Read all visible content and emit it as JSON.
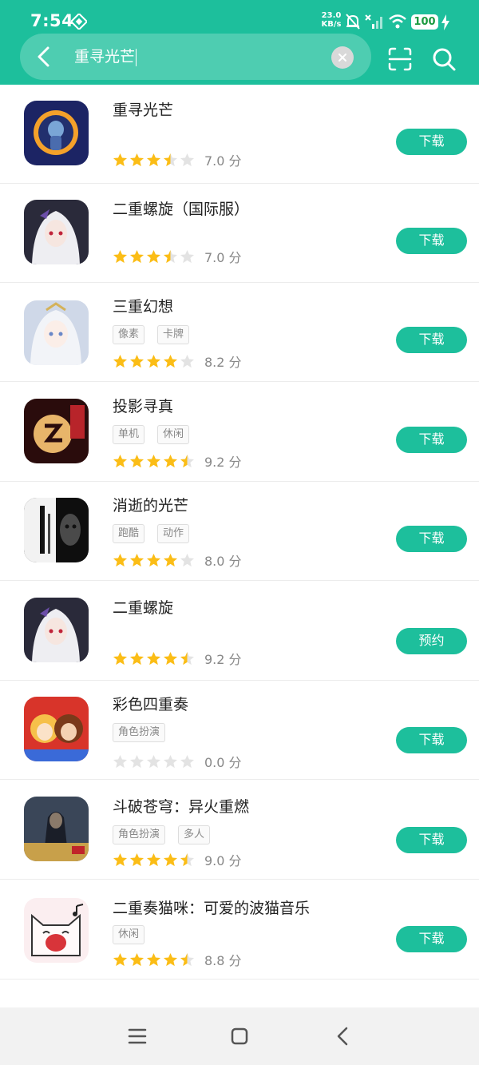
{
  "status_bar": {
    "time": "7:54",
    "net_speed_value": "23.0",
    "net_speed_unit": "KB/s",
    "battery": "100"
  },
  "search": {
    "query": "重寻光芒"
  },
  "colors": {
    "accent": "#1dbf9c",
    "star_on": "#fbbd16",
    "star_off": "#e3e3e3"
  },
  "icons": {
    "back": "chevron-left-icon",
    "clear": "close-icon",
    "scan": "scan-icon",
    "search": "search-icon",
    "nav_menu": "menu-icon",
    "nav_home": "home-square-icon",
    "nav_back": "back-triangle-icon"
  },
  "results": [
    {
      "name": "重寻光芒",
      "tags": [],
      "stars": 3.5,
      "score": "7.0 分",
      "button": "下载"
    },
    {
      "name": "二重螺旋（国际服）",
      "tags": [],
      "stars": 3.5,
      "score": "7.0 分",
      "button": "下载"
    },
    {
      "name": "三重幻想",
      "tags": [
        "像素",
        "卡牌"
      ],
      "stars": 4,
      "score": "8.2 分",
      "button": "下载"
    },
    {
      "name": "投影寻真",
      "tags": [
        "单机",
        "休闲"
      ],
      "stars": 4.5,
      "score": "9.2 分",
      "button": "下载"
    },
    {
      "name": "消逝的光芒",
      "tags": [
        "跑酷",
        "动作"
      ],
      "stars": 4,
      "score": "8.0 分",
      "button": "下载"
    },
    {
      "name": "二重螺旋",
      "tags": [],
      "stars": 4.5,
      "score": "9.2 分",
      "button": "预约"
    },
    {
      "name": "彩色四重奏",
      "tags": [
        "角色扮演"
      ],
      "stars": 0,
      "score": "0.0 分",
      "button": "下载"
    },
    {
      "name": "斗破苍穹：异火重燃",
      "tags": [
        "角色扮演",
        "多人"
      ],
      "stars": 4.5,
      "score": "9.0 分",
      "button": "下载"
    },
    {
      "name": "二重奏猫咪：可爱的波猫音乐",
      "tags": [
        "休闲"
      ],
      "stars": 4.5,
      "score": "8.8 分",
      "button": "下载"
    }
  ]
}
